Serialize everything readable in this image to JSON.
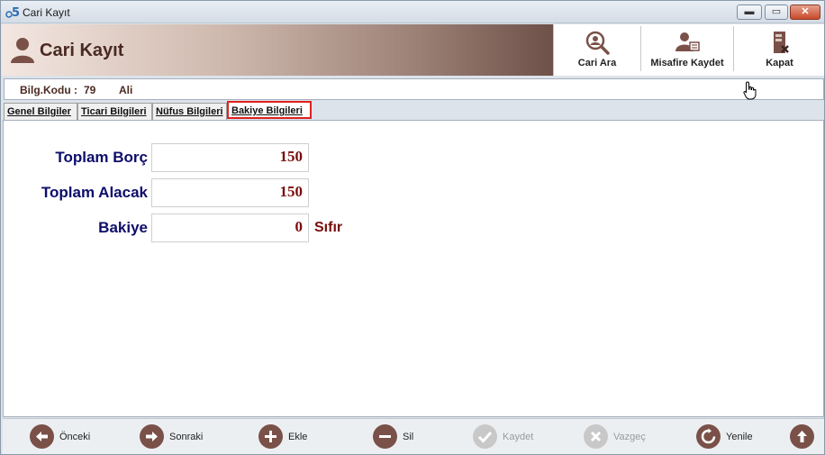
{
  "window": {
    "title": "Cari Kayıt"
  },
  "header": {
    "title": "Cari Kayıt"
  },
  "toolbar": {
    "search_label": "Cari Ara",
    "guest_label": "Misafire Kaydet",
    "close_label": "Kapat"
  },
  "infobar": {
    "code_label": "Bilg.Kodu :",
    "code_value": "79",
    "name_value": "Ali"
  },
  "tabs": [
    {
      "label": "Genel Bilgiler"
    },
    {
      "label": "Ticari Bilgileri"
    },
    {
      "label": "Nüfus Bilgileri"
    },
    {
      "label": "Bakiye Bilgileri"
    }
  ],
  "active_tab": "Bakiye Bilgileri",
  "fields": {
    "total_debt": {
      "label": "Toplam Borç",
      "value": "150"
    },
    "total_credit": {
      "label": "Toplam Alacak",
      "value": "150"
    },
    "balance": {
      "label": "Bakiye",
      "value": "0",
      "text": "Sıfır"
    }
  },
  "bottom": {
    "prev": "Önceki",
    "next": "Sonraki",
    "add": "Ekle",
    "delete": "Sil",
    "save": "Kaydet",
    "cancel": "Vazgeç",
    "refresh": "Yenile"
  },
  "colors": {
    "accent": "#7a5148",
    "active_tab_border": "#e02020",
    "label_color": "#0d0d6b",
    "value_color": "#7a0c0c"
  }
}
